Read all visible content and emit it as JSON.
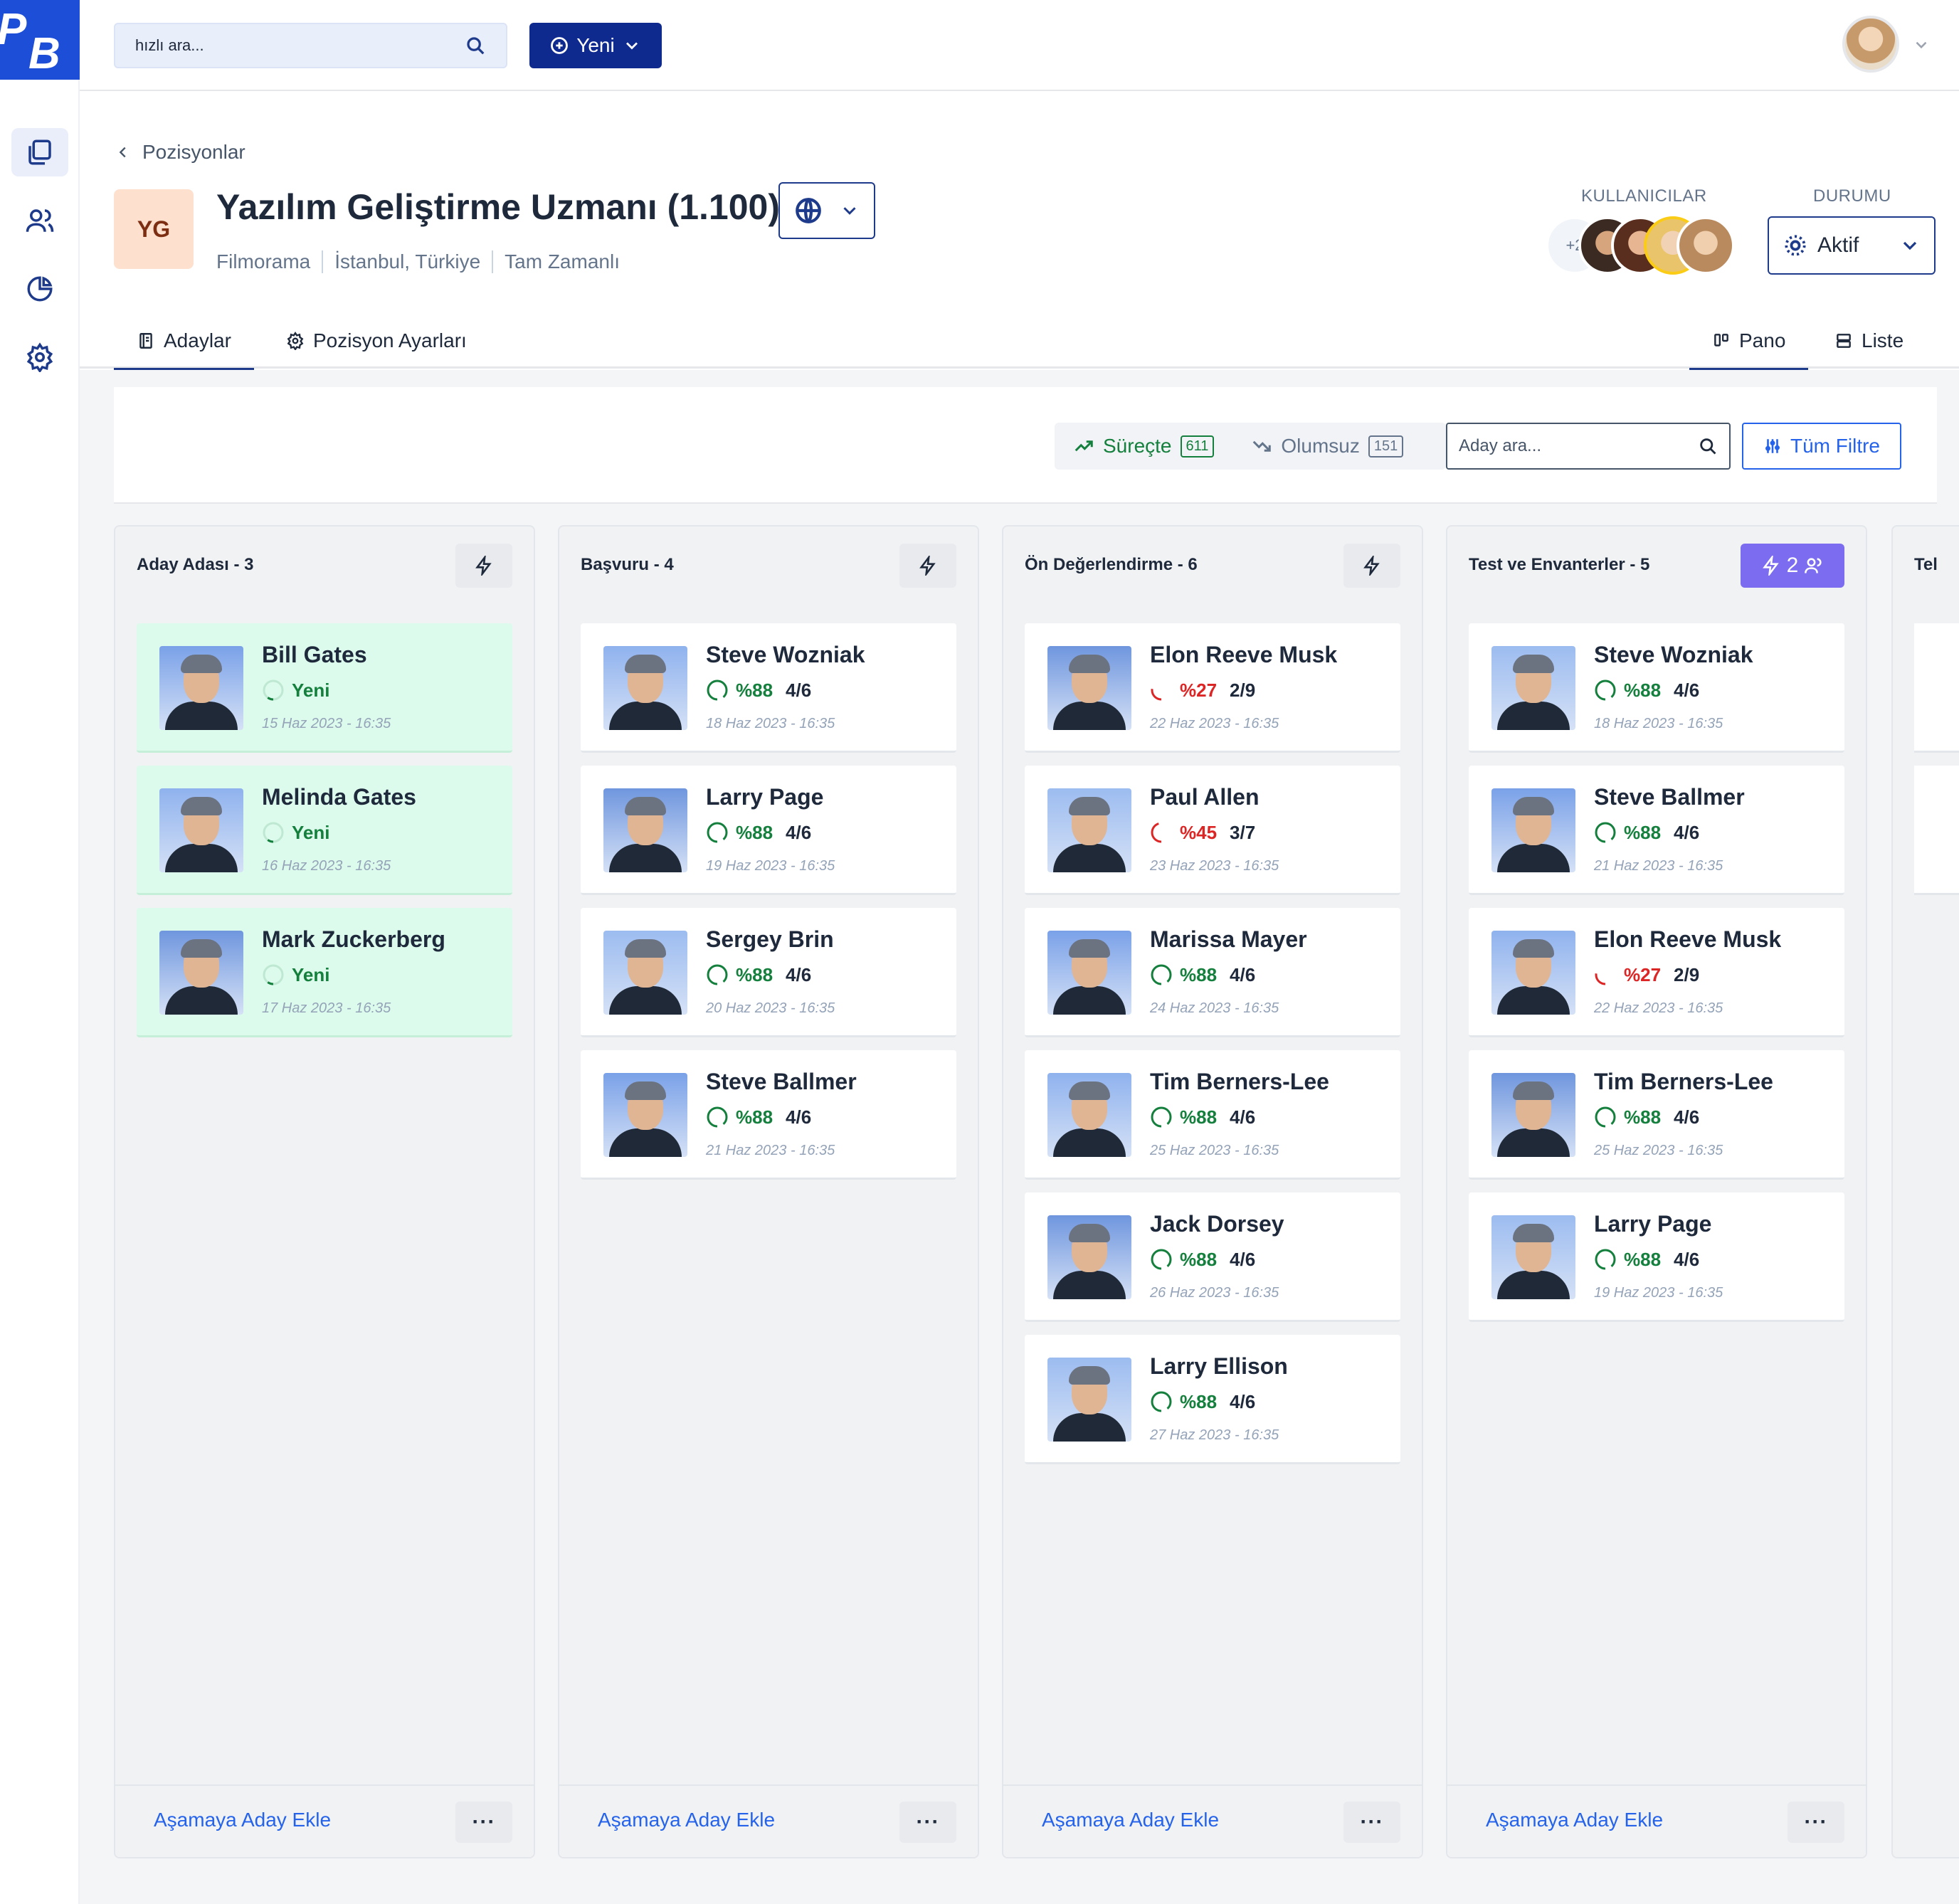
{
  "app": {
    "logo_text_1": "P",
    "logo_text_2": "B"
  },
  "sidebar": {
    "items": [
      {
        "name": "positions",
        "icon": "files-icon",
        "active": true
      },
      {
        "name": "users",
        "icon": "users-icon",
        "active": false
      },
      {
        "name": "reports",
        "icon": "pie-chart-icon",
        "active": false
      },
      {
        "name": "settings",
        "icon": "gear-icon",
        "active": false
      }
    ]
  },
  "topbar": {
    "search_placeholder": "hızlı ara...",
    "new_label": "Yeni"
  },
  "header": {
    "back_label": "Pozisyonlar",
    "initials": "YG",
    "title": "Yazılım Geliştirme Uzmanı (1.100)",
    "company": "Filmorama",
    "location": "İstanbul, Türkiye",
    "work_type": "Tam Zamanlı",
    "users_label": "KULLANICILAR",
    "users_more": "+2",
    "status_label": "DURUMU",
    "status_value": "Aktif"
  },
  "tabs": {
    "candidates": "Adaylar",
    "settings": "Pozisyon Ayarları",
    "board": "Pano",
    "list": "Liste"
  },
  "filters": {
    "in_process_label": "Süreçte",
    "in_process_count": "611",
    "negative_label": "Olumsuz",
    "negative_count": "151",
    "search_placeholder": "Aday ara...",
    "all_filters_label": "Tüm Filtre"
  },
  "colors": {
    "primary": "#1e3a8a",
    "accent": "#2563eb",
    "success": "#15803d",
    "danger": "#dc2626",
    "new_card": "#dcfbec",
    "automation": "#7c6cf0"
  },
  "board": {
    "add_label": "Aşamaya Aday Ekle",
    "more_label": "···",
    "partial_column_label": "Tel",
    "columns": [
      {
        "title": "Aday Adası",
        "sep": " - ",
        "count": "3",
        "automation": null,
        "cards": [
          {
            "name": "Bill Gates",
            "pct": "",
            "status": "Yeni",
            "step": "",
            "date": "15 Haz 2023 - 16:35",
            "tone": "new",
            "score": 0.1
          },
          {
            "name": "Melinda Gates",
            "pct": "",
            "status": "Yeni",
            "step": "",
            "date": "16 Haz 2023 - 16:35",
            "tone": "new",
            "score": 0.1
          },
          {
            "name": "Mark Zuckerberg",
            "pct": "",
            "status": "Yeni",
            "step": "",
            "date": "17 Haz 2023 - 16:35",
            "tone": "new",
            "score": 0.1
          }
        ]
      },
      {
        "title": "Başvuru",
        "sep": " - ",
        "count": "4",
        "automation": null,
        "cards": [
          {
            "name": "Steve Wozniak",
            "pct": "%88",
            "status": "",
            "step": "4/6",
            "date": "18 Haz 2023 - 16:35",
            "tone": "green",
            "score": 0.88
          },
          {
            "name": "Larry Page",
            "pct": "%88",
            "status": "",
            "step": "4/6",
            "date": "19 Haz 2023 - 16:35",
            "tone": "green",
            "score": 0.88
          },
          {
            "name": "Sergey Brin",
            "pct": "%88",
            "status": "",
            "step": "4/6",
            "date": "20 Haz 2023 - 16:35",
            "tone": "green",
            "score": 0.88
          },
          {
            "name": "Steve Ballmer",
            "pct": "%88",
            "status": "",
            "step": "4/6",
            "date": "21 Haz 2023 - 16:35",
            "tone": "green",
            "score": 0.88
          }
        ]
      },
      {
        "title": "Ön Değerlendirme",
        "sep": " - ",
        "count": "6",
        "automation": null,
        "cards": [
          {
            "name": "Elon Reeve Musk",
            "pct": "%27",
            "status": "",
            "step": "2/9",
            "date": "22 Haz 2023 - 16:35",
            "tone": "red",
            "score": 0.27
          },
          {
            "name": "Paul Allen",
            "pct": "%45",
            "status": "",
            "step": "3/7",
            "date": "23 Haz 2023 - 16:35",
            "tone": "red",
            "score": 0.45
          },
          {
            "name": "Marissa Mayer",
            "pct": "%88",
            "status": "",
            "step": "4/6",
            "date": "24 Haz 2023 - 16:35",
            "tone": "green",
            "score": 0.88
          },
          {
            "name": "Tim Berners-Lee",
            "pct": "%88",
            "status": "",
            "step": "4/6",
            "date": "25 Haz 2023 - 16:35",
            "tone": "green",
            "score": 0.88
          },
          {
            "name": "Jack Dorsey",
            "pct": "%88",
            "status": "",
            "step": "4/6",
            "date": "26 Haz 2023 - 16:35",
            "tone": "green",
            "score": 0.88
          },
          {
            "name": "Larry Ellison",
            "pct": "%88",
            "status": "",
            "step": "4/6",
            "date": "27 Haz 2023 - 16:35",
            "tone": "green",
            "score": 0.88
          }
        ]
      },
      {
        "title": "Test ve Envanterler",
        "sep": " - ",
        "count": "5",
        "automation": "2",
        "cards": [
          {
            "name": "Steve Wozniak",
            "pct": "%88",
            "status": "",
            "step": "4/6",
            "date": "18 Haz 2023 - 16:35",
            "tone": "green",
            "score": 0.88
          },
          {
            "name": "Steve Ballmer",
            "pct": "%88",
            "status": "",
            "step": "4/6",
            "date": "21 Haz 2023 - 16:35",
            "tone": "green",
            "score": 0.88
          },
          {
            "name": "Elon Reeve Musk",
            "pct": "%27",
            "status": "",
            "step": "2/9",
            "date": "22 Haz 2023 - 16:35",
            "tone": "red",
            "score": 0.27
          },
          {
            "name": "Tim Berners-Lee",
            "pct": "%88",
            "status": "",
            "step": "4/6",
            "date": "25 Haz 2023 - 16:35",
            "tone": "green",
            "score": 0.88
          },
          {
            "name": "Larry Page",
            "pct": "%88",
            "status": "",
            "step": "4/6",
            "date": "19 Haz 2023 - 16:35",
            "tone": "green",
            "score": 0.88
          }
        ]
      }
    ]
  }
}
